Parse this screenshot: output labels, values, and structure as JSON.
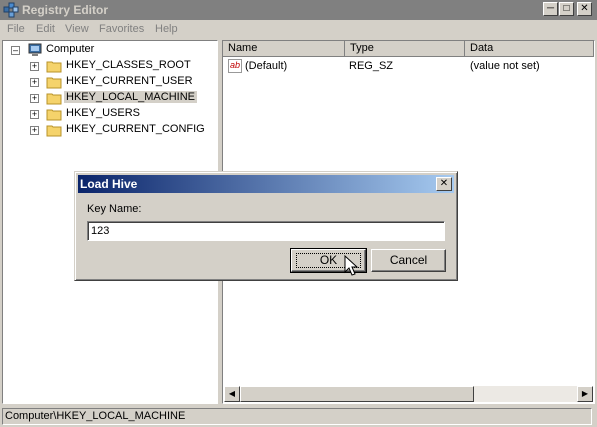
{
  "window": {
    "title": "Registry Editor",
    "controls": [
      "minimize",
      "maximize",
      "close"
    ]
  },
  "menu": [
    {
      "label": "File"
    },
    {
      "label": "Edit"
    },
    {
      "label": "View"
    },
    {
      "label": "Favorites"
    },
    {
      "label": "Help"
    }
  ],
  "tree": {
    "root": "Computer",
    "items": [
      {
        "label": "HKEY_CLASSES_ROOT"
      },
      {
        "label": "HKEY_CURRENT_USER"
      },
      {
        "label": "HKEY_LOCAL_MACHINE"
      },
      {
        "label": "HKEY_USERS"
      },
      {
        "label": "HKEY_CURRENT_CONFIG"
      }
    ],
    "selected": "HKEY_LOCAL_MACHINE"
  },
  "list": {
    "columns": [
      "Name",
      "Type",
      "Data"
    ],
    "rows": [
      {
        "icon": "ab",
        "name": "(Default)",
        "type": "REG_SZ",
        "data": "(value not set)"
      }
    ]
  },
  "status": "Computer\\HKEY_LOCAL_MACHINE",
  "dialog": {
    "title": "Load Hive",
    "label": "Key Name:",
    "value": "123",
    "ok": "OK",
    "cancel": "Cancel"
  },
  "colors": {
    "face": "#d4d0c8",
    "inactive_title": "#808080",
    "active_title_start": "#0a246a",
    "active_title_end": "#a6caf0"
  }
}
